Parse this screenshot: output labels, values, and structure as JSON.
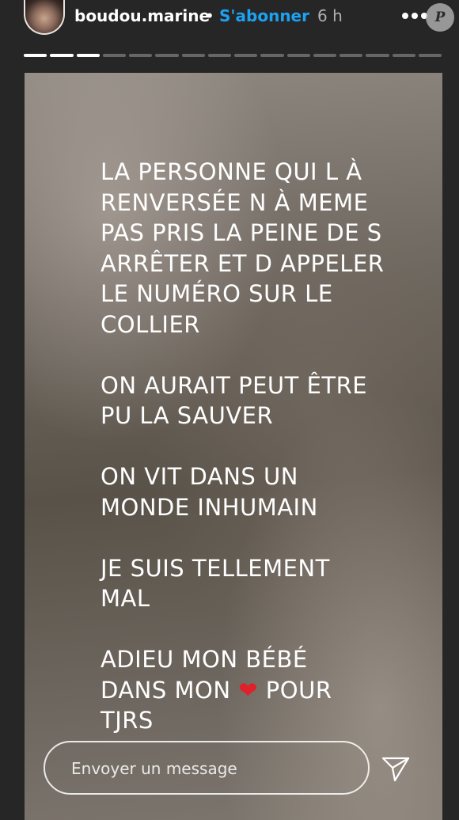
{
  "header": {
    "username": "boudou.marine",
    "separator": "•",
    "follow_label": "S'abonner",
    "time_ago": "6 h",
    "watermark_letter": "P"
  },
  "progress": {
    "total_segments": 16,
    "current_segment": 3
  },
  "story": {
    "paragraphs": [
      "LA PERSONNE QUI L À\nRENVERSÉE N À MEME\nPAS PRIS LA PEINE DE S\nARRÊTER ET D APPELER\nLE NUMÉRO SUR LE\nCOLLIER",
      "ON AURAIT PEUT ÊTRE\nPU LA SAUVER",
      "ON VIT DANS UN\nMONDE INHUMAIN",
      "JE SUIS TELLEMENT\nMAL"
    ],
    "last_paragraph": {
      "line1": "ADIEU MON BÉBÉ",
      "line2_before": "DANS MON ",
      "heart": "❤",
      "line2_after": " POUR",
      "line3": "TJRS"
    }
  },
  "reply": {
    "placeholder": "Envoyer un message"
  },
  "icons": {
    "more": "more-options-icon",
    "send": "paper-plane-icon"
  },
  "colors": {
    "follow": "#1da1f2",
    "heart": "#e0202a",
    "background": "#262626"
  }
}
